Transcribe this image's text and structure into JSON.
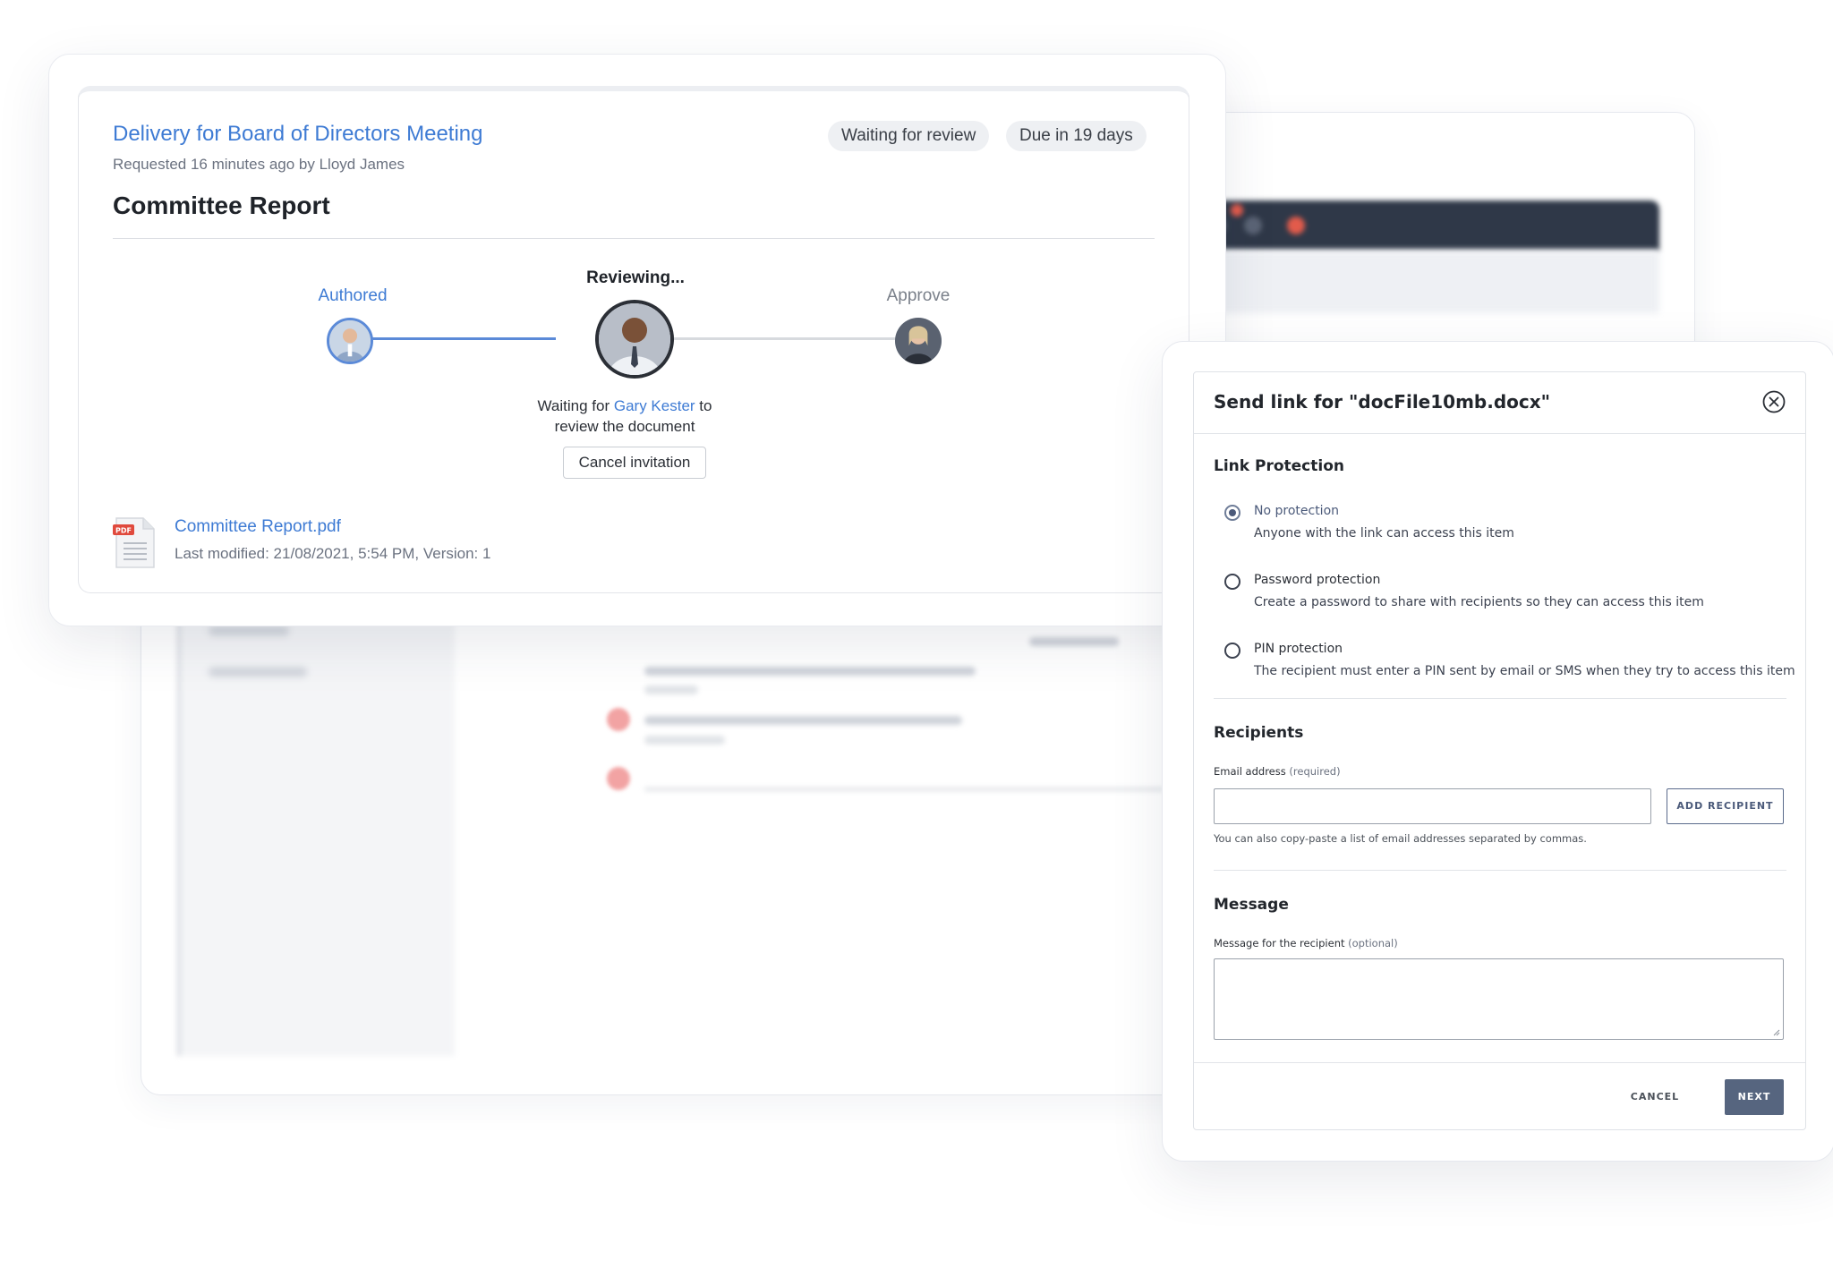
{
  "delivery": {
    "title": "Delivery for Board of Directors Meeting",
    "requested": "Requested 16 minutes ago by Lloyd James",
    "status_pill": "Waiting for review",
    "due_pill": "Due in 19 days",
    "report_title": "Committee Report"
  },
  "workflow": {
    "steps": [
      {
        "label": "Authored",
        "color": "#3e7bd4"
      },
      {
        "label": "Reviewing...",
        "color": "#1f2329"
      },
      {
        "label": "Approve",
        "color": "#7a808a"
      }
    ],
    "waiting_prefix": "Waiting for ",
    "waiting_person": "Gary Kester",
    "waiting_suffix": " to",
    "waiting_line2": "review the document",
    "cancel_label": "Cancel invitation",
    "progress_color": "#5b8ad8"
  },
  "file": {
    "icon_badge": "PDF",
    "name": "Committee Report.pdf",
    "meta": "Last modified: 21/08/2021, 5:54 PM, Version: 1"
  },
  "modal": {
    "title": "Send link for \"docFile10mb.docx\"",
    "link_protection_heading": "Link Protection",
    "options": [
      {
        "label": "No protection",
        "desc": "Anyone with the link can access this item",
        "selected": true
      },
      {
        "label": "Password protection",
        "desc": "Create a password to share with recipients so they can access this item",
        "selected": false
      },
      {
        "label": "PIN protection",
        "desc": "The recipient must enter a PIN sent by email or SMS when they try to access this item",
        "selected": false
      }
    ],
    "recipients_heading": "Recipients",
    "email_label": "Email address",
    "email_required": "(required)",
    "email_value": "",
    "add_recipient": "ADD RECIPIENT",
    "email_help": "You can also copy-paste a list of email addresses separated by commas.",
    "message_heading": "Message",
    "message_label": "Message for the recipient",
    "message_optional": "(optional)",
    "message_value": "",
    "cancel": "CANCEL",
    "next": "NEXT"
  }
}
